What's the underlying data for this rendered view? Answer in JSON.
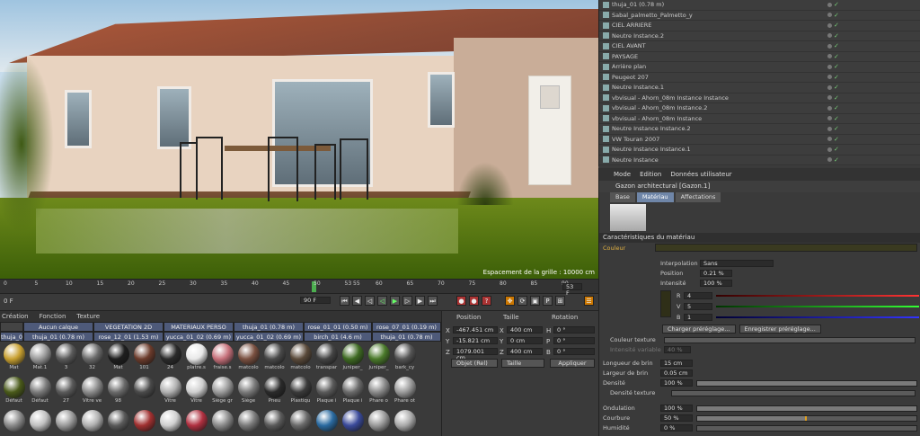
{
  "viewport": {
    "grid_spacing_text": "Espacement de la grille : 10000 cm"
  },
  "object_manager": {
    "rows": [
      {
        "name": "thuja_01 (0.78 m)"
      },
      {
        "name": "Sabal_palmetto_Palmetto_y"
      },
      {
        "name": "CIEL ARRIERE"
      },
      {
        "name": "Neutre Instance.2"
      },
      {
        "name": "CIEL AVANT"
      },
      {
        "name": "PAYSAGE"
      },
      {
        "name": "Arrière plan"
      },
      {
        "name": "Peugeot 207"
      },
      {
        "name": "Neutre Instance.1"
      },
      {
        "name": "vbvisual - Ahorn_08m Instance Instance"
      },
      {
        "name": "vbvisual - Ahorn_08m Instance.2"
      },
      {
        "name": "vbvisual - Ahorn_08m Instance"
      },
      {
        "name": "Neutre Instance Instance.2"
      },
      {
        "name": "VW Touran 2007"
      },
      {
        "name": "Neutre Instance Instance.1"
      },
      {
        "name": "Neutre Instance"
      }
    ]
  },
  "attributes": {
    "menu": [
      "Mode",
      "Edition",
      "Données utilisateur"
    ],
    "material_name": "Gazon architectural [Gazon.1]",
    "tabs": [
      "Base",
      "Matériau",
      "Affectations"
    ],
    "active_tab": "Matériau",
    "section_title": "Caractéristiques du matériau",
    "color_label": "Couleur",
    "interpolation_label": "Interpolation",
    "interpolation_value": "Sans",
    "position_label": "Position",
    "position_value": "0.21 %",
    "intensity_label": "Intensité",
    "intensity_value": "100 %",
    "r_label": "R",
    "r_value": "4",
    "v_label": "V",
    "v_value": "5",
    "b_label": "B",
    "b_value": "1",
    "load_preset": "Charger préréglage...",
    "save_preset": "Enregistrer préréglage...",
    "color_texture_label": "Couleur texture",
    "variable_intensity_label": "Intensité variable",
    "variable_intensity_value": "40 %",
    "blade_length_label": "Longueur de brin",
    "blade_length_value": "15 cm",
    "blade_width_label": "Largeur de brin",
    "blade_width_value": "0.05 cm",
    "density_label": "Densité",
    "density_value": "100 %",
    "density_texture_label": "Densité texture",
    "ondulation_label": "Ondulation",
    "ondulation_value": "100 %",
    "ondulation_level": 1.0,
    "courbure_label": "Courbure",
    "courbure_value": "50 %",
    "courbure_level": 0.5,
    "humidity_label": "Humidité",
    "humidity_value": "0 %",
    "humidity_level": 0.0
  },
  "timeline": {
    "ticks": [
      "0",
      "5",
      "10",
      "15",
      "20",
      "25",
      "30",
      "35",
      "40",
      "45",
      "50",
      "53 55",
      "60",
      "65",
      "70",
      "75",
      "80",
      "85",
      "90"
    ],
    "current_frame": "0 F",
    "end_frame": "90 F",
    "marker_frame": "53 F"
  },
  "material_manager": {
    "menu": [
      "Création",
      "Fonction",
      "Texture"
    ],
    "layer_tabs_top": [
      "Aucun calque",
      "VEGETATION 2D",
      "MATERIAUX PERSO",
      "thuja_01 (0.78 m)",
      "rose_01_01 (0.50 m)",
      "rose_07_01 (0.19 m)"
    ],
    "layer_tabs_bottom": [
      "thuja_01 (2.18 m)",
      "thuja_01 (0.78 m)",
      "rose_12_01 (1.53 m)",
      "yucca_01_02 (0.69 m)",
      "yucca_01_02 (0.69 m)",
      "birch_01 (4.6 m)",
      "thuja_01 (0.78 m)"
    ],
    "materials": [
      {
        "label": "Mat",
        "color": "#c8a030"
      },
      {
        "label": "Mat.1",
        "color": "#9a9a9a"
      },
      {
        "label": "3",
        "color": "#5a5a5a"
      },
      {
        "label": "32",
        "color": "#6a6a6a"
      },
      {
        "label": "Mat",
        "color": "#1e1e1e"
      },
      {
        "label": "101",
        "color": "#6b3b2b"
      },
      {
        "label": "24",
        "color": "#2a2a2a"
      },
      {
        "label": "platre.s",
        "color": "#e8e8e8"
      },
      {
        "label": "fraise.s",
        "color": "#c6707a"
      },
      {
        "label": "matcolo",
        "color": "#7a5040"
      },
      {
        "label": "matcolo",
        "color": "#4a4a4a"
      },
      {
        "label": "matcolo",
        "color": "#5a4a3a"
      },
      {
        "label": "transpar",
        "color": "#444444"
      },
      {
        "label": "juniper_",
        "color": "#3e6a22"
      },
      {
        "label": "juniper_",
        "color": "#4a7a2a"
      },
      {
        "label": "bark_cy",
        "color": "#555555"
      },
      {
        "label": "Défaut",
        "color": "#4a5a1a"
      },
      {
        "label": "Défaut",
        "color": "#7a7a7a"
      },
      {
        "label": "27",
        "color": "#5a5a5a"
      },
      {
        "label": "Vitre ve",
        "color": "#8a8a8a"
      },
      {
        "label": "98",
        "color": "#6a6a6a"
      },
      {
        "label": "",
        "color": "#4a4a4a"
      },
      {
        "label": "Vitre",
        "color": "#b0b0b0"
      },
      {
        "label": "Vitre",
        "color": "#cfcfcf"
      },
      {
        "label": "Siège gr",
        "color": "#9a9a9a"
      },
      {
        "label": "Siège",
        "color": "#7a7a7a"
      },
      {
        "label": "Pneu",
        "color": "#2a2a2a"
      },
      {
        "label": "Plastiqu",
        "color": "#3a3a3a"
      },
      {
        "label": "Plaque i",
        "color": "#5a5a5a"
      },
      {
        "label": "Plaque i",
        "color": "#6a6a6a"
      },
      {
        "label": "Phare o",
        "color": "#8a8a8a"
      },
      {
        "label": "Phare ot",
        "color": "#9a9a9a"
      },
      {
        "label": "",
        "color": "#8a8a8a"
      },
      {
        "label": "",
        "color": "#c0c0c0"
      },
      {
        "label": "",
        "color": "#9a9a9a"
      },
      {
        "label": "",
        "color": "#b0b0b0"
      },
      {
        "label": "",
        "color": "#5a5a5a"
      },
      {
        "label": "",
        "color": "#a03030"
      },
      {
        "label": "",
        "color": "#cfcfcf"
      },
      {
        "label": "",
        "color": "#b03040"
      },
      {
        "label": "",
        "color": "#8a8a8a"
      },
      {
        "label": "",
        "color": "#7a7a7a"
      },
      {
        "label": "",
        "color": "#5a5a5a"
      },
      {
        "label": "",
        "color": "#6a6a6a"
      },
      {
        "label": "",
        "color": "#2a6aa0"
      },
      {
        "label": "",
        "color": "#3a4a9a"
      },
      {
        "label": "",
        "color": "#9a9a9a"
      },
      {
        "label": "",
        "color": "#aaaaaa"
      }
    ]
  },
  "coordinates": {
    "headers": [
      "Position",
      "Taille",
      "Rotation"
    ],
    "x_label": "X",
    "x_pos": "-467.451 cm",
    "x_size": "400 cm",
    "h_label": "H",
    "h_rot": "0 °",
    "y_label": "Y",
    "y_pos": "-15.821 cm",
    "y_size": "0 cm",
    "p_label": "P",
    "p_rot": "0 °",
    "z_label": "Z",
    "z_pos": "1079.001 cm",
    "z_size": "400 cm",
    "b_label": "B",
    "b_rot": "0 °",
    "mode_select": "Objet (Rel)",
    "size_select": "Taille",
    "apply_button": "Appliquer"
  }
}
